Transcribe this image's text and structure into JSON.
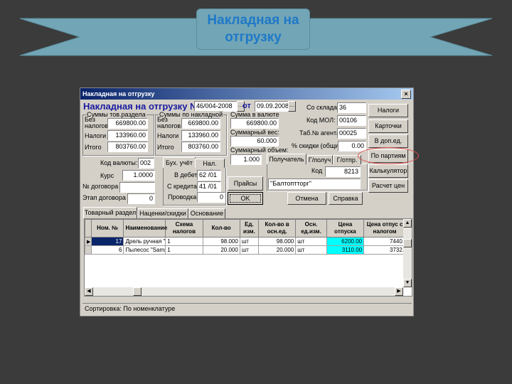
{
  "banner": {
    "title": "Накладная на отгрузку",
    "ribbon_color": "#72a6b6",
    "text_color": "#1f78c8"
  },
  "window": {
    "title": "Накладная на отгрузку",
    "close": "×"
  },
  "header": {
    "label": "Накладная на отгрузку №",
    "number": "46/004-2008",
    "from_label": "от",
    "date": "09.09.2008"
  },
  "sums_goods": {
    "legend": "Суммы тов.раздела",
    "no_tax_label": "Без налогов",
    "no_tax": "669800.00",
    "tax_label": "Налоги",
    "tax": "133960.00",
    "total_label": "Итого",
    "total": "803760.00"
  },
  "sums_invoice": {
    "legend": "Суммы по накладной",
    "no_tax_label": "Без налогов",
    "no_tax": "669800.00",
    "tax_label": "Налоги",
    "tax": "133960.00",
    "total_label": "Итого",
    "total": "803760.00"
  },
  "currency_sum": {
    "label": "Сумма в валюте",
    "value": "669800.00"
  },
  "weight": {
    "label": "Суммарный вес:",
    "value": "60.000"
  },
  "volume": {
    "label": "Суммарный объем:",
    "value": "1.000"
  },
  "warehouse": {
    "label": "Со склада",
    "value": "36"
  },
  "mol": {
    "label": "Код МОЛ:",
    "value": "00106"
  },
  "agent": {
    "label": "Таб.№ агента:",
    "value": "00025"
  },
  "discount": {
    "label": "% скидки (общий)",
    "value": "0.00"
  },
  "currency": {
    "label": "Код валюты:",
    "value": "002"
  },
  "rate": {
    "label": "Курс",
    "value": "1.0000"
  },
  "contract": {
    "label": "№ договора",
    "value": ""
  },
  "stage": {
    "label": "Этап договора",
    "value": "0"
  },
  "acc_tabs": [
    "Бух. учёт",
    "Нал. учёт"
  ],
  "debit": {
    "label": "В дебет",
    "value": "62 /01"
  },
  "credit": {
    "label": "С кредита",
    "value": "41 /01"
  },
  "posting": {
    "label": "Проводка",
    "value": "0"
  },
  "recipient_tabs": [
    "Получатель",
    "Г/получ",
    "Г/отпр."
  ],
  "recipient": {
    "code_label": "Код",
    "code": "8213",
    "name": "\"Балтоптторг\""
  },
  "buttons": {
    "prices": "Прайсы",
    "ok": "OK",
    "cancel": "Отмена",
    "help": "Справка"
  },
  "side_buttons": [
    "Налоги",
    "Карточки",
    "В доп.ед.",
    "По партиям",
    "Калькулятор",
    "Расчет цен"
  ],
  "highlight_color": "#e05050",
  "main_tabs": [
    "Товарный раздел",
    "Наценки/скидки",
    "Основание"
  ],
  "table": {
    "columns": [
      "Ном. №",
      "Наименование",
      "Схема налогов",
      "Кол-во",
      "Ед. изм.",
      "Кол-во в осн.ед.",
      "Осн. ед.изм.",
      "Цена отпуска",
      "Цена отпус с налогом"
    ],
    "rows": [
      [
        "17",
        "Дрель ручная \"Bo",
        "1",
        "98.000",
        "шт",
        "98.000",
        "шт",
        "6200.00",
        "7440."
      ],
      [
        "6",
        "Пылесос \"Samsun",
        "1",
        "20.000",
        "шт",
        "20.000",
        "шт",
        "3110.00",
        "3732."
      ]
    ],
    "price_highlight": "#00ffff"
  },
  "status": "Сортировка: По номенклатуре"
}
